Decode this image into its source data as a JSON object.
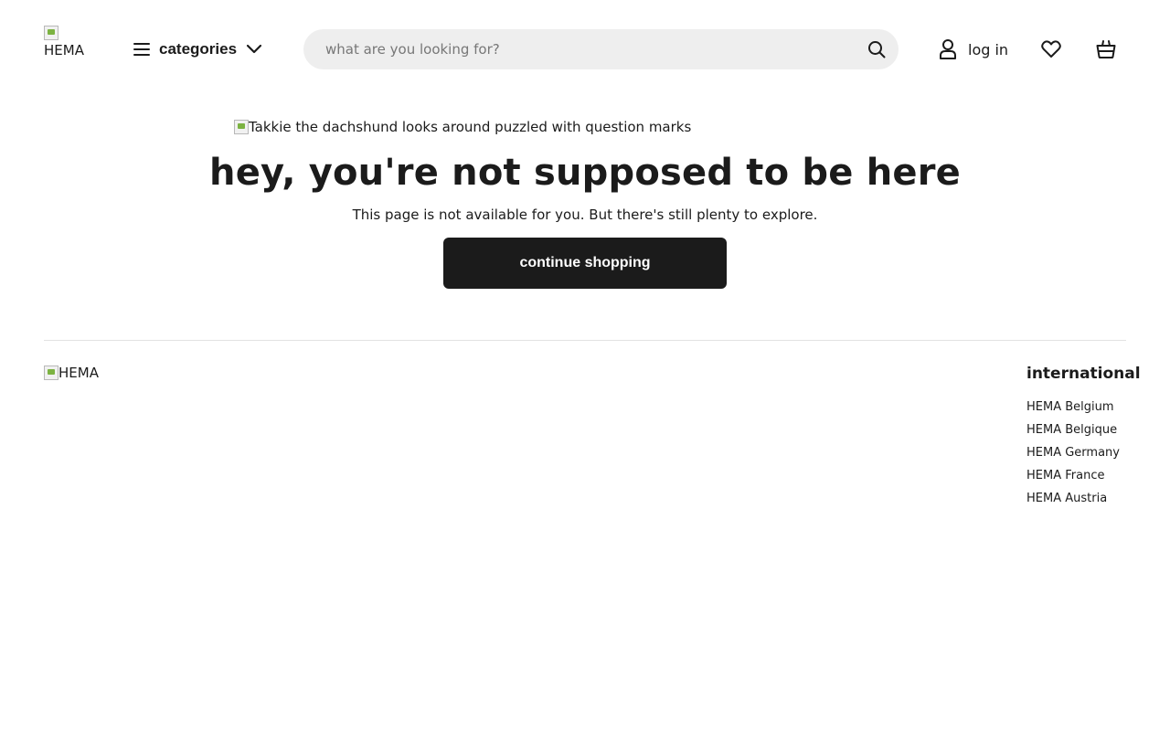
{
  "header": {
    "logo_alt": "HEMA",
    "categories_label": "categories",
    "search_placeholder": "what are you looking for?",
    "login_label": "log in",
    "icons": [
      "menu-icon",
      "chevron-down-icon",
      "search-icon",
      "user-icon",
      "heart-icon",
      "basket-icon"
    ]
  },
  "main": {
    "image_alt": "Takkie the dachshund looks around puzzled with question marks",
    "title": "hey, you're not supposed to be here",
    "subtitle": "This page is not available for you. But there's still plenty to explore.",
    "cta_label": "continue shopping"
  },
  "footer": {
    "logo_alt": "HEMA",
    "international": {
      "title": "international",
      "links": [
        {
          "label": "HEMA Belgium"
        },
        {
          "label": "HEMA Belgique"
        },
        {
          "label": "HEMA Germany"
        },
        {
          "label": "HEMA France"
        },
        {
          "label": "HEMA Austria"
        }
      ]
    }
  },
  "colors": {
    "text": "#1b1b1b",
    "search_bg": "#eeeeee",
    "button_bg": "#1b1b1b",
    "button_text": "#ffffff",
    "divider": "#e2e2e2"
  }
}
